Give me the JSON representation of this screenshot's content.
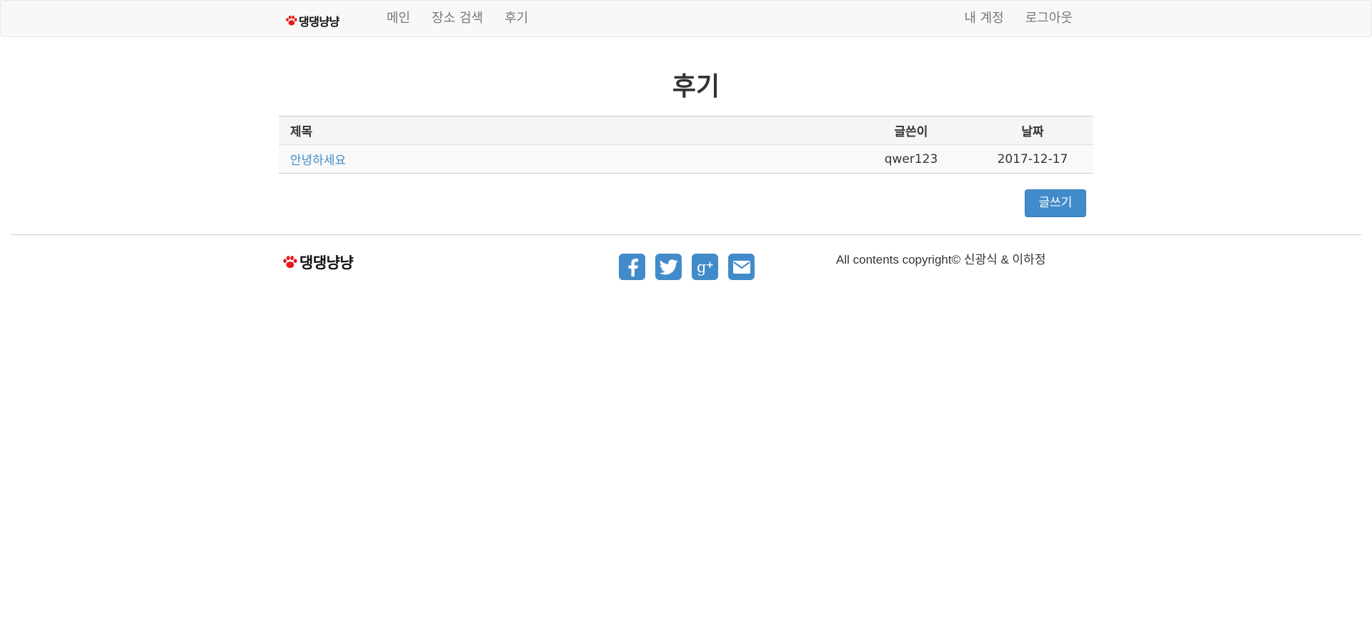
{
  "brand": {
    "name": "댕댕냥냥"
  },
  "nav": {
    "left": [
      {
        "label": "메인"
      },
      {
        "label": "장소 검색"
      },
      {
        "label": "후기"
      }
    ],
    "right": [
      {
        "label": "내 계정"
      },
      {
        "label": "로그아웃"
      }
    ]
  },
  "page": {
    "title": "후기"
  },
  "table": {
    "headers": {
      "title": "제목",
      "author": "글쓴이",
      "date": "날짜"
    },
    "rows": [
      {
        "title": "안녕하세요",
        "author": "qwer123",
        "date": "2017-12-17"
      }
    ]
  },
  "actions": {
    "write_label": "글쓰기"
  },
  "footer": {
    "brand": "댕댕냥냥",
    "social": [
      "facebook-icon",
      "twitter-icon",
      "google-plus-icon",
      "mail-icon"
    ],
    "copyright": "All contents copyright© 신광식 & 이하정"
  },
  "colors": {
    "accent": "#428bca",
    "paw": "#e8191c",
    "navbar_bg": "#f8f8f8"
  }
}
